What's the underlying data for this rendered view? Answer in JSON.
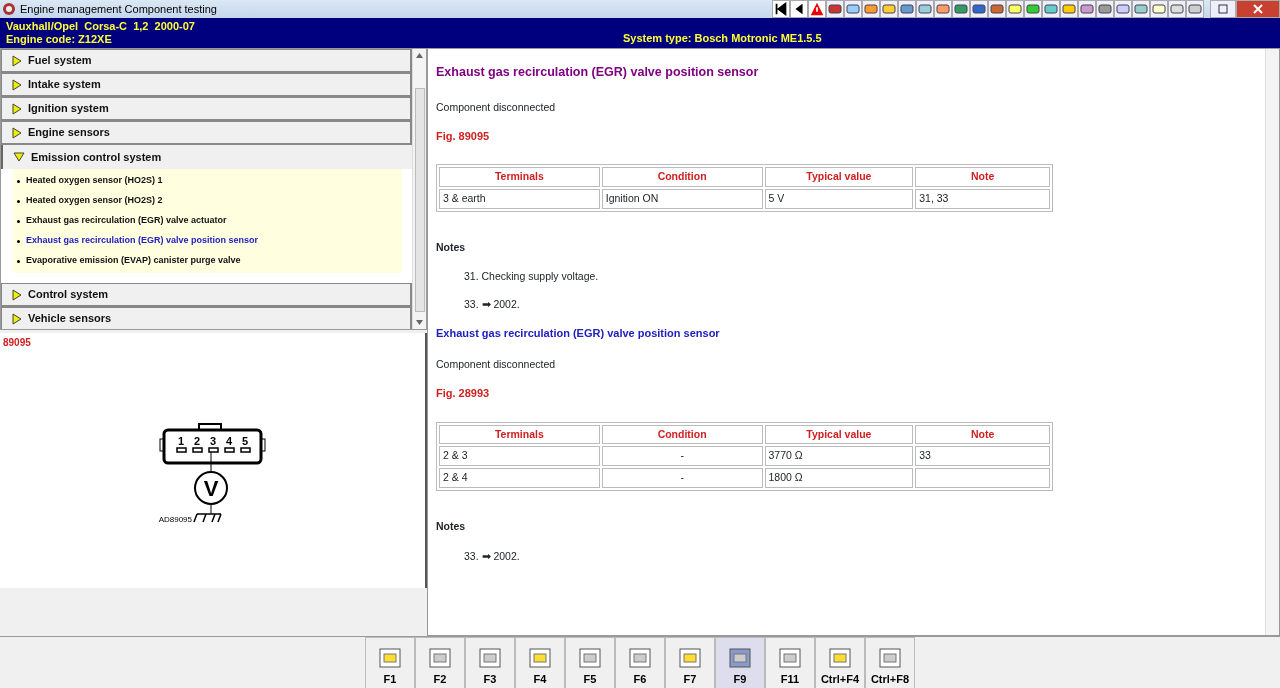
{
  "window": {
    "title": "Engine management Component testing"
  },
  "header": {
    "vehicle": "Vauxhall/Opel  Corsa-C  1,2  2000-07",
    "engine": "Engine code: Z12XE",
    "system": "System type: Bosch Motronic ME1.5.5"
  },
  "sidebar": {
    "sections": [
      {
        "label": "Fuel system",
        "expanded": false
      },
      {
        "label": "Intake system",
        "expanded": false
      },
      {
        "label": "Ignition system",
        "expanded": false
      },
      {
        "label": "Engine sensors",
        "expanded": false
      },
      {
        "label": "Emission control system",
        "expanded": true,
        "items": [
          {
            "label": "Heated oxygen sensor (HO2S) 1",
            "selected": false
          },
          {
            "label": "Heated oxygen sensor (HO2S) 2",
            "selected": false
          },
          {
            "label": "Exhaust gas recirculation (EGR) valve actuator",
            "selected": false
          },
          {
            "label": "Exhaust gas recirculation (EGR) valve position sensor",
            "selected": true
          },
          {
            "label": "Evaporative emission (EVAP) canister purge valve",
            "selected": false
          }
        ]
      },
      {
        "label": "Control system",
        "expanded": false
      },
      {
        "label": "Vehicle sensors",
        "expanded": false
      }
    ]
  },
  "figure": {
    "label": "89095",
    "pins": [
      "1",
      "2",
      "3",
      "4",
      "5"
    ],
    "meter": "V",
    "code": "AD89095"
  },
  "content": [
    {
      "title": "Exhaust gas recirculation (EGR) valve position sensor",
      "kind": "visited",
      "condition": "Component disconnected",
      "fig": "Fig. 89095",
      "columns": [
        "Terminals",
        "Condition",
        "Typical value",
        "Note"
      ],
      "rows": [
        [
          "3 & earth",
          "Ignition ON",
          "5 V",
          "31, 33"
        ]
      ],
      "notes_title": "Notes",
      "notes": [
        {
          "num": "31.",
          "text": "Checking supply voltage."
        },
        {
          "num": "33.",
          "text": "➡ 2002."
        }
      ]
    },
    {
      "title": "Exhaust gas recirculation (EGR) valve position sensor",
      "kind": "link",
      "condition": "Component disconnected",
      "fig": "Fig. 28993",
      "columns": [
        "Terminals",
        "Condition",
        "Typical value",
        "Note"
      ],
      "rows": [
        [
          "2 & 3",
          "-",
          "3770 Ω",
          "33"
        ],
        [
          "2 & 4",
          "-",
          "1800 Ω",
          ""
        ]
      ],
      "notes_title": "Notes",
      "notes": [
        {
          "num": "33.",
          "text": "➡ 2002."
        }
      ]
    }
  ],
  "function_keys": [
    {
      "label": "F1",
      "selected": false
    },
    {
      "label": "F2",
      "selected": false
    },
    {
      "label": "F3",
      "selected": false
    },
    {
      "label": "F4",
      "selected": false
    },
    {
      "label": "F5",
      "selected": false
    },
    {
      "label": "F6",
      "selected": false
    },
    {
      "label": "F7",
      "selected": false
    },
    {
      "label": "F9",
      "selected": true
    },
    {
      "label": "F11",
      "selected": false
    },
    {
      "label": "Ctrl+F4",
      "selected": false
    },
    {
      "label": "Ctrl+F8",
      "selected": false
    }
  ]
}
